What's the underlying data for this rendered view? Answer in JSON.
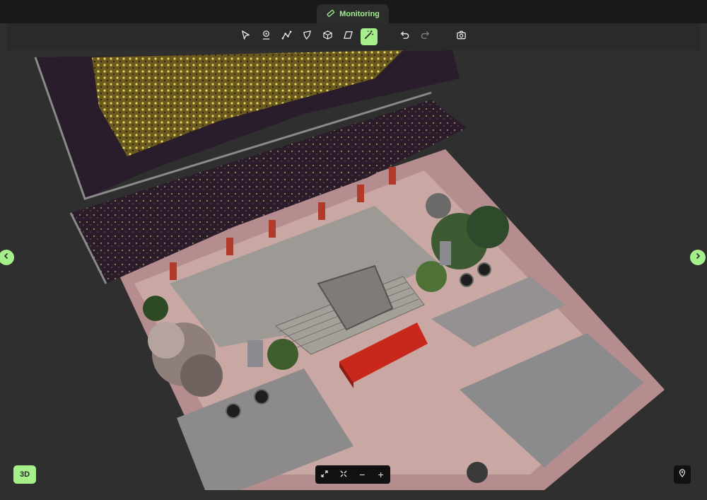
{
  "header": {
    "mode_tab_label": "Monitoring",
    "mode_icon": "ruler-icon"
  },
  "toolbar": {
    "tools": [
      "cursor-icon",
      "location-pin-icon",
      "polyline-icon",
      "polygon-icon",
      "cube-icon",
      "plane-icon",
      "magic-wand-icon"
    ],
    "active_tool": "magic-wand-icon",
    "history": [
      "undo-icon",
      "redo-icon"
    ],
    "extra": [
      "camera-icon"
    ]
  },
  "viewport": {
    "content": "3d-point-cloud-model",
    "prev_icon": "chevron-left-icon",
    "next_icon": "chevron-right-icon"
  },
  "footer": {
    "view_mode_label": "3D",
    "zoom_controls": {
      "fit_icon": "expand-icon",
      "center_icon": "crosshair-icon",
      "zoom_out_label": "−",
      "zoom_in_label": "+"
    },
    "location_icon": "map-pin-icon"
  },
  "colors": {
    "accent": "#a6f08b",
    "background": "#2f2f2f",
    "topbar": "#191919"
  }
}
